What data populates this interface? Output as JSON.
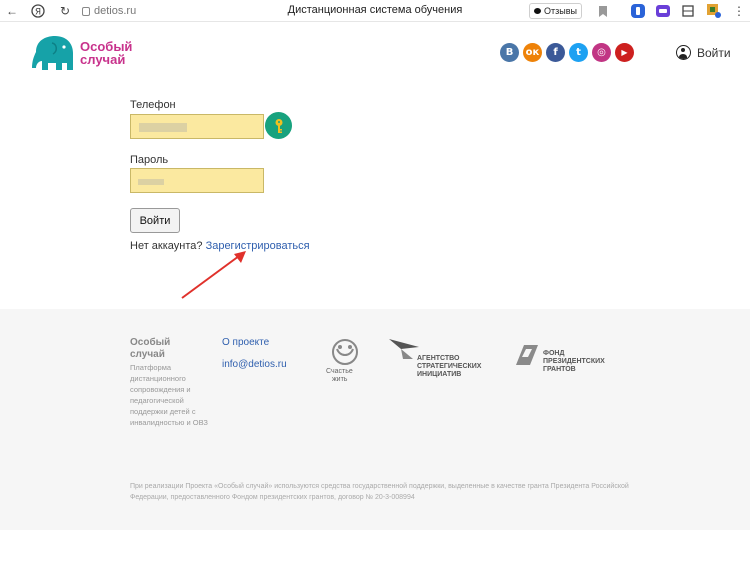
{
  "browser": {
    "url": "detios.ru",
    "title": "Дистанционная система обучения",
    "reviews_label": "Отзывы"
  },
  "header": {
    "logo_line1": "Особый",
    "logo_line2": "случай",
    "socials": [
      {
        "name": "vk",
        "glyph": "В",
        "color": "#4a76a8"
      },
      {
        "name": "odnoklassniki",
        "glyph": "ок",
        "color": "#ee8208"
      },
      {
        "name": "facebook",
        "glyph": "f",
        "color": "#3b5998"
      },
      {
        "name": "twitter",
        "glyph": "t",
        "color": "#1da1f2"
      },
      {
        "name": "instagram",
        "glyph": "◎",
        "color": "#c13584"
      },
      {
        "name": "youtube",
        "glyph": "▶",
        "color": "#cd201f"
      }
    ],
    "login_label": "Войти"
  },
  "form": {
    "phone_label": "Телефон",
    "password_label": "Пароль",
    "submit_label": "Войти",
    "no_account_text": "Нет аккаунта?",
    "register_link": "Зарегистрироваться"
  },
  "footer": {
    "brand_line1": "Особый",
    "brand_line2": "случай",
    "description": "Платформа дистанционного сопровождения и педагогической поддержки детей с инвалидностью и ОВЗ",
    "about_link": "О проекте",
    "email_link": "info@detios.ru",
    "partners": {
      "schastye_line1": "Счастье",
      "schastye_line2": "жить",
      "asi_line1": "АГЕНТСТВО",
      "asi_line2": "СТРАТЕГИЧЕСКИХ",
      "asi_line3": "ИНИЦИАТИВ",
      "fpg_line1": "ФОНД",
      "fpg_line2": "ПРЕЗИДЕНТСКИХ",
      "fpg_line3": "ГРАНТОВ"
    },
    "legal": "При реализации Проекта «Особый случай» используются средства государственной поддержки, выделенные в качестве гранта Президента Российской Федерации, предоставленного Фондом президентских грантов, договор № 20-3-008994"
  }
}
